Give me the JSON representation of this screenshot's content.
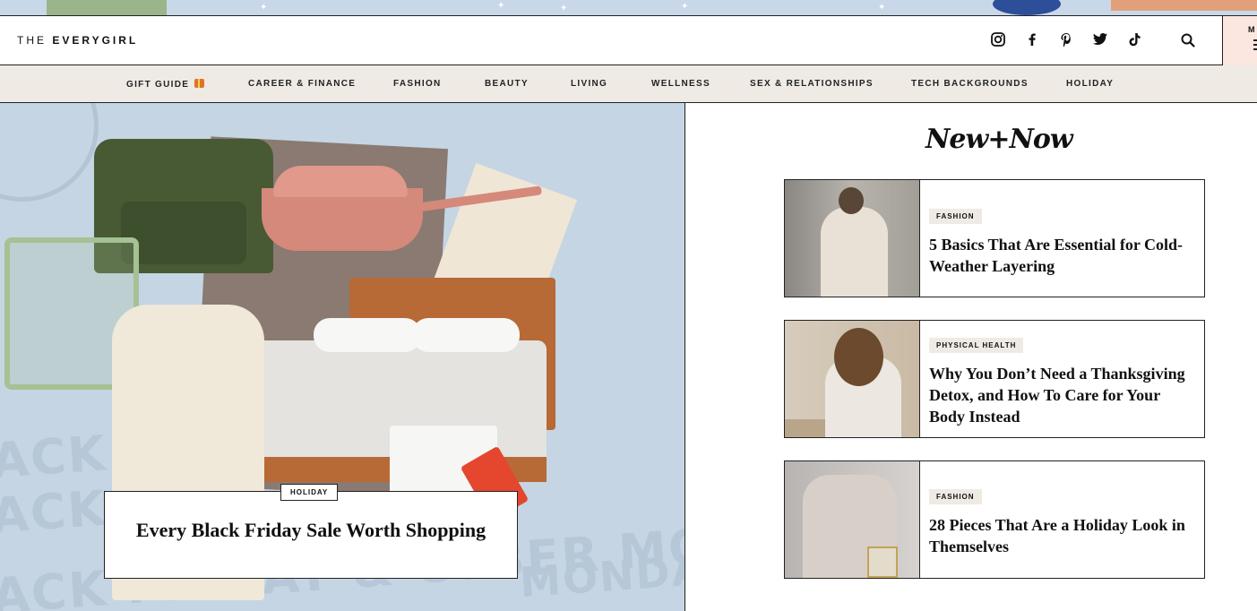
{
  "logo": {
    "prefix": "THE",
    "brand": "EVERYGIRL"
  },
  "header": {
    "social_icons": [
      "instagram-icon",
      "facebook-icon",
      "pinterest-icon",
      "twitter-icon",
      "tiktok-icon"
    ],
    "search_icon": "search-icon",
    "menu_label": "M"
  },
  "nav": {
    "items": [
      {
        "label": "GIFT GUIDE"
      },
      {
        "label": "CAREER & FINANCE"
      },
      {
        "label": "FASHION"
      },
      {
        "label": "BEAUTY"
      },
      {
        "label": "LIVING"
      },
      {
        "label": "WELLNESS"
      },
      {
        "label": "SEX & RELATIONSHIPS"
      },
      {
        "label": "TECH BACKGROUNDS"
      },
      {
        "label": "HOLIDAY"
      }
    ]
  },
  "hero": {
    "category": "HOLIDAY",
    "title": "Every Black Friday Sale Worth Shopping",
    "watermark_lines": [
      "ACK FR",
      "ACK",
      "ACK FRIDAY & CYBER MONDAY",
      "MONDAY"
    ]
  },
  "sidebar": {
    "heading": "New+Now",
    "articles": [
      {
        "category": "FASHION",
        "headline": "5 Basics That Are Essential for Cold-Weather Layering"
      },
      {
        "category": "PHYSICAL HEALTH",
        "headline": "Why You Don’t Need a Thanksgiving Detox, and How To Care for Your Body Instead"
      },
      {
        "category": "FASHION",
        "headline": "28 Pieces That Are a Holiday Look in Themselves"
      }
    ]
  },
  "colors": {
    "hero_bg": "#c5d5e4",
    "nav_bg": "#efeae4",
    "menu_bg": "#fbe7df",
    "border": "#222222"
  }
}
